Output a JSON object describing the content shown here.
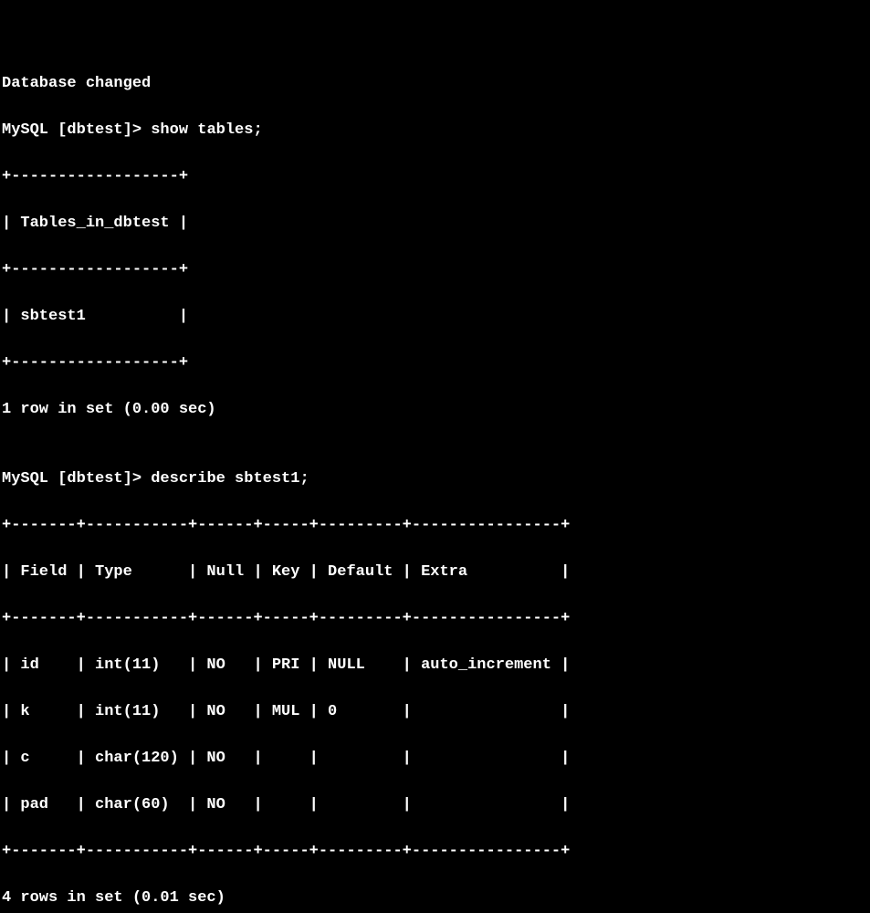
{
  "status_line": "Database changed",
  "prompt1": "MySQL [dbtest]> ",
  "cmd1": "show tables;",
  "table1": {
    "border": "+------------------+",
    "header": "| Tables_in_dbtest |",
    "row": "| sbtest1          |"
  },
  "result1": "1 row in set (0.00 sec)",
  "blank": "",
  "prompt2": "MySQL [dbtest]> ",
  "cmd2": "describe sbtest1;",
  "table2": {
    "border": "+-------+-----------+------+-----+---------+----------------+",
    "header": "| Field | Type      | Null | Key | Default | Extra          |",
    "row1": "| id    | int(11)   | NO   | PRI | NULL    | auto_increment |",
    "row2": "| k     | int(11)   | NO   | MUL | 0       |                |",
    "row3": "| c     | char(120) | NO   |     |         |                |",
    "row4": "| pad   | char(60)  | NO   |     |         |                |"
  },
  "result2": "4 rows in set (0.01 sec)"
}
